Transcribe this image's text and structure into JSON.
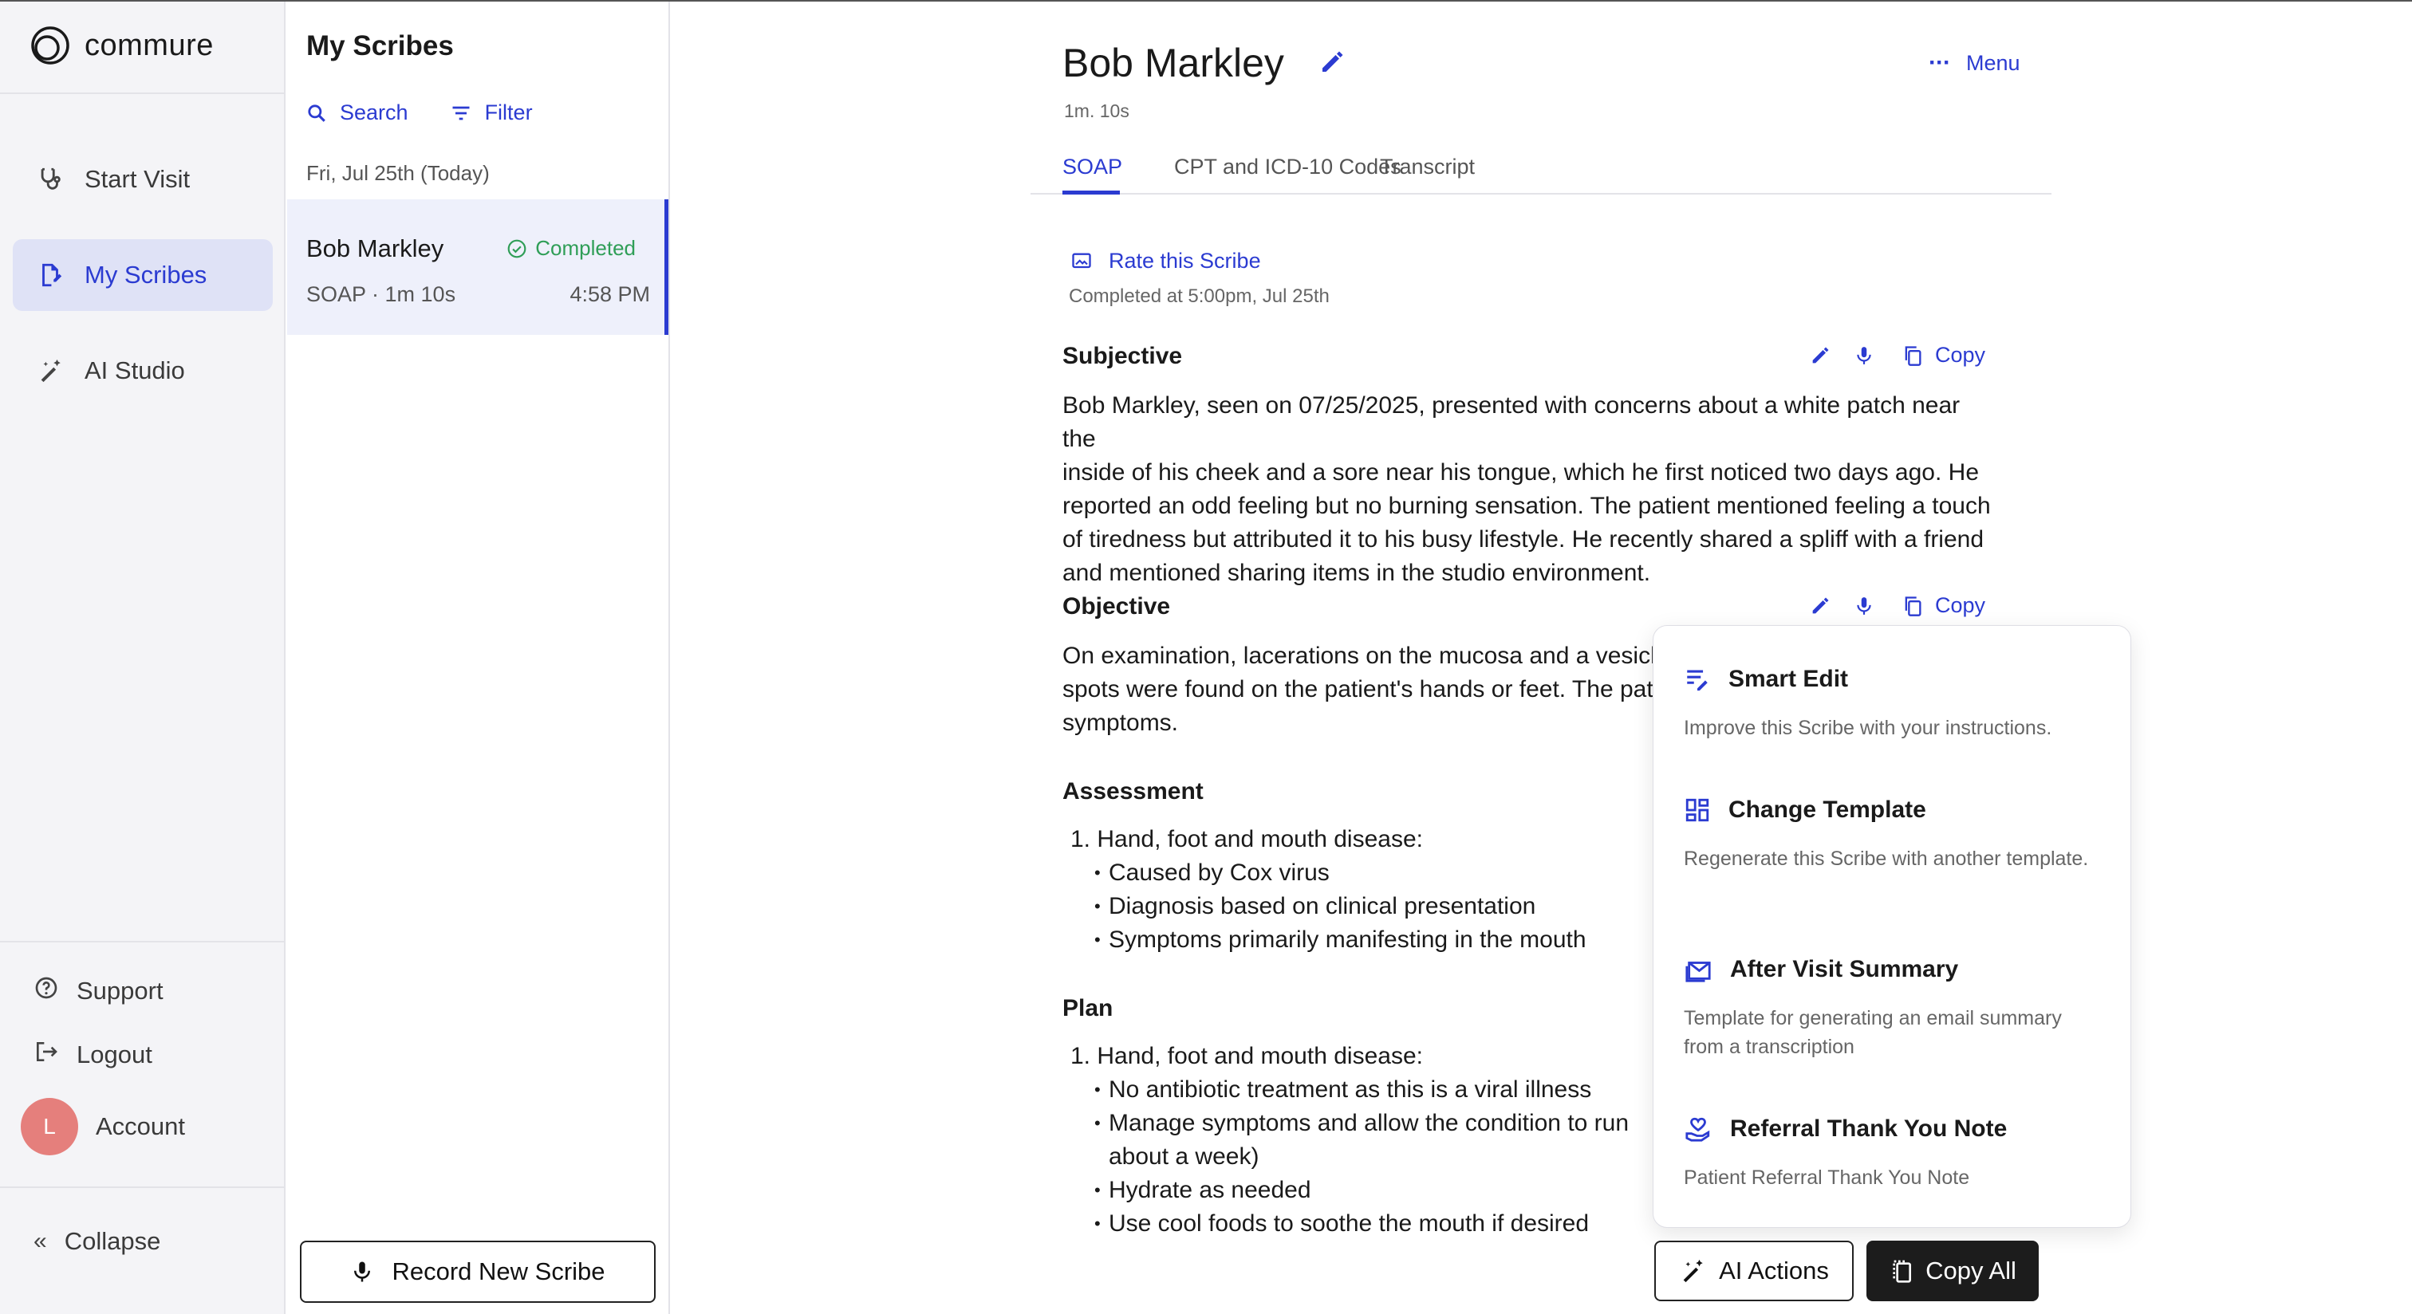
{
  "brand": {
    "name": "commure",
    "icon": "commure-logo"
  },
  "nav": {
    "items": [
      {
        "label": "Start Visit",
        "icon": "stethoscope-icon",
        "active": false
      },
      {
        "label": "My Scribes",
        "icon": "scribe-document-icon",
        "active": true
      },
      {
        "label": "AI Studio",
        "icon": "magic-wand-icon",
        "active": false
      }
    ],
    "support": "Support",
    "logout": "Logout",
    "account": {
      "label": "Account",
      "initial": "L"
    },
    "collapse": "Collapse"
  },
  "list": {
    "title": "My Scribes",
    "search": "Search",
    "filter": "Filter",
    "date_header": "Fri, Jul 25th (Today)",
    "scribes": [
      {
        "name": "Bob Markley",
        "status": "Completed",
        "meta": "SOAP · 1m 10s",
        "time": "4:58 PM"
      }
    ],
    "record_button": "Record New Scribe"
  },
  "main": {
    "patient_name": "Bob Markley",
    "duration": "1m. 10s",
    "menu": "Menu",
    "tabs": [
      {
        "label": "SOAP",
        "active": true
      },
      {
        "label": "CPT and ICD-10 Codes",
        "active": false
      },
      {
        "label": "Transcript",
        "active": false
      }
    ],
    "rate": "Rate this Scribe",
    "completed_at": "Completed at 5:00pm, Jul 25th",
    "copy_label": "Copy",
    "subjective": {
      "title": "Subjective",
      "lines": [
        "Bob Markley, seen on 07/25/2025, presented with concerns about a white patch near the",
        "inside of his cheek and a sore near his tongue, which he first noticed two days ago. He",
        "reported an odd feeling but no burning sensation. The patient mentioned feeling a touch",
        "of tiredness but attributed it to his busy lifestyle. He recently shared a spliff with a friend",
        "and mentioned sharing items in the studio environment."
      ]
    },
    "objective": {
      "title": "Objective",
      "lines": [
        "On examination, lacerations on the mucosa and a vesicle",
        "spots were found on the patient's hands or feet. The pat",
        "symptoms."
      ]
    },
    "assessment": {
      "title": "Assessment",
      "item": "1.  Hand, foot and mouth disease:",
      "bullets": [
        "Caused by Cox virus",
        "Diagnosis based on clinical presentation",
        "Symptoms primarily manifesting in the mouth"
      ]
    },
    "plan": {
      "title": "Plan",
      "item": "1.  Hand, foot and mouth disease:",
      "bullets": [
        "No antibiotic treatment as this is a viral illness",
        "Manage symptoms and allow the condition to run",
        "about a week)",
        "Hydrate as needed",
        "Use cool foods to soothe the mouth if desired"
      ]
    }
  },
  "ai_menu": {
    "items": [
      {
        "title": "Smart Edit",
        "desc": "Improve this Scribe with your instructions.",
        "icon": "smart-edit-icon"
      },
      {
        "title": "Change Template",
        "desc": "Regenerate this Scribe with another template.",
        "icon": "template-grid-icon"
      },
      {
        "title": "After Visit Summary",
        "desc": "Template for generating an email summary from a transcription",
        "icon": "email-icon"
      },
      {
        "title": "Referral Thank You Note",
        "desc": "Patient Referral Thank You Note",
        "icon": "heart-hand-icon"
      }
    ]
  },
  "footer": {
    "ai_actions": "AI Actions",
    "copy_all": "Copy All"
  },
  "colors": {
    "accent": "#2b3bd1",
    "success": "#2f9e57",
    "nav_bg": "#f4f4f7",
    "active_bg": "#dfe2f6",
    "avatar": "#e57f7c"
  }
}
